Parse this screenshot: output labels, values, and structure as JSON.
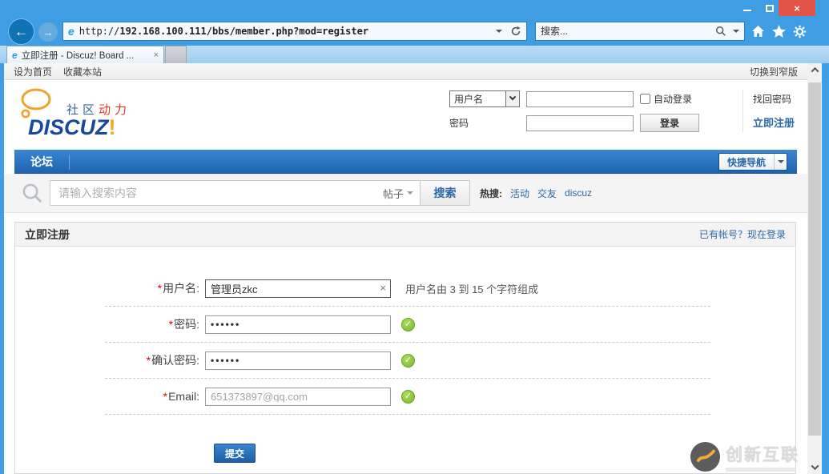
{
  "glyphs": {
    "close": "×",
    "back": "←",
    "forward": "→",
    "check": "✓",
    "clear": "×"
  },
  "browser": {
    "url_scheme": "http://",
    "url_host": "192.168.100.111",
    "url_path": "/bbs/member.php?mod=register",
    "search_placeholder": "搜索...",
    "tab_title": "立即注册 - Discuz! Board ...",
    "ie_glyph": "e"
  },
  "page_toolbar": {
    "set_home": "设为首页",
    "favorite": "收藏本站",
    "switch_layout": "切换到窄版"
  },
  "site_header": {
    "tagline_blue": "社区",
    "tagline_red": "动力",
    "logo_main": "DISCUZ",
    "logo_bang": "!",
    "login": {
      "account_type": "用户名",
      "password_label": "密码",
      "auto_login_label": "自动登录",
      "find_password": "找回密码",
      "login_button": "登录",
      "register_link": "立即注册"
    }
  },
  "site_nav": {
    "forum": "论坛",
    "quick_nav": "快捷导航"
  },
  "site_search": {
    "placeholder": "请输入搜索内容",
    "scope": "帖子",
    "button": "搜索",
    "hot_label": "热搜:",
    "hot_links": [
      "活动",
      "交友",
      "discuz"
    ]
  },
  "register": {
    "panel_title": "立即注册",
    "login_link": "已有帐号？现在登录",
    "required_mark": "*",
    "fields": {
      "username": {
        "label": "用户名:",
        "value": "管理员zkc",
        "hint": "用户名由 3 到 15 个字符组成"
      },
      "password": {
        "label": "密码:",
        "value": "••••••"
      },
      "confirm": {
        "label": "确认密码:",
        "value": "••••••"
      },
      "email": {
        "label": "Email:",
        "value": "651373897@qq.com"
      }
    },
    "submit": "提交"
  },
  "watermark": {
    "brand": "创新互联"
  },
  "colors": {
    "chrome_blue": "#3f9de4",
    "close_red": "#e25348",
    "nav_gradient_top": "#3a87d2",
    "nav_gradient_bottom": "#1f63ae",
    "link_blue": "#2a69a8",
    "valid_green": "#8dc63f",
    "logo_blue": "#16499c",
    "logo_orange": "#f6a623"
  }
}
